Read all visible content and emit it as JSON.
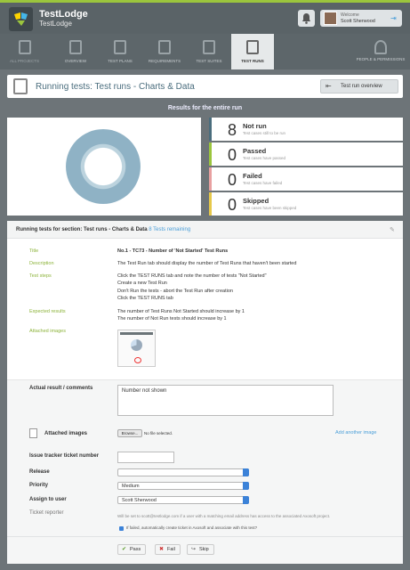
{
  "header": {
    "app_name": "TestLodge",
    "account_name": "TestLodge",
    "welcome": "Welcome",
    "user_name": "Scott Sherwood",
    "accent": "#9bc53d"
  },
  "nav": [
    {
      "label": "ALL PROJECTS",
      "icon": "folder-icon"
    },
    {
      "label": "OVERVIEW",
      "icon": "overview-icon"
    },
    {
      "label": "TEST PLANS",
      "icon": "plans-icon"
    },
    {
      "label": "REQUIREMENTS",
      "icon": "requirements-icon"
    },
    {
      "label": "TEST SUITES",
      "icon": "suites-icon"
    },
    {
      "label": "TEST RUNS",
      "icon": "runs-icon"
    },
    {
      "label": "PEOPLE & PERMISSIONS",
      "icon": "people-icon"
    }
  ],
  "page": {
    "title": "Running tests: Test runs - Charts & Data",
    "overview_button": "Test run overview"
  },
  "results": {
    "title": "Results for the entire run",
    "stats": [
      {
        "count": "8",
        "name": "Not run",
        "desc": "Test cases still to be run",
        "color": "#4a6d7d"
      },
      {
        "count": "0",
        "name": "Passed",
        "desc": "Test cases have passed",
        "color": "#9bc53d"
      },
      {
        "count": "0",
        "name": "Failed",
        "desc": "Test cases have failed",
        "color": "#e8a0a0"
      },
      {
        "count": "0",
        "name": "Skipped",
        "desc": "Test cases have been skipped",
        "color": "#e6c84a"
      }
    ]
  },
  "section": {
    "heading": "Running tests for section: Test runs - Charts & Data",
    "remaining": "8 Tests remaining",
    "labels": {
      "title": "Title",
      "description": "Description",
      "steps": "Test steps",
      "expected": "Expected results",
      "images": "Attached images"
    },
    "title_value": "No.1 - TC73 - Number of 'Not Started' Test Runs",
    "description_value": "The Test Run tab should display the number of Test Runs that haven't been started",
    "steps": [
      "Click the TEST RUNS tab and note the number of tests \"Not Started\"",
      "Create a new Test Run",
      "Don't Run the tests - abort the Test Run after creation",
      "Click the TEST RUNS tab"
    ],
    "expected": [
      "The number of Test Runs Not Started should increase by 1",
      "The number of Not Run tests should increase by 1"
    ]
  },
  "form": {
    "actual_label": "Actual result / comments",
    "actual_value": "Number not shown",
    "attached_label": "Attached images",
    "browse": "Browse...",
    "no_file": "No file selected.",
    "add_image": "Add another image",
    "issue_label": "Issue tracker ticket number",
    "release_label": "Release",
    "release_value": "",
    "priority_label": "Priority",
    "priority_value": "Medium",
    "assign_label": "Assign to user",
    "assign_value": "Scott Sherwood",
    "reporter_label": "Ticket reporter",
    "reporter_note": "Will be set to scott@testlodge.com if a user with a matching email address has access to the associated Axosoft project.",
    "checkbox_label": "If failed, automatically create ticket in Axosoft and associate with this test?",
    "pass": "Pass",
    "fail": "Fail",
    "skip": "Skip"
  }
}
